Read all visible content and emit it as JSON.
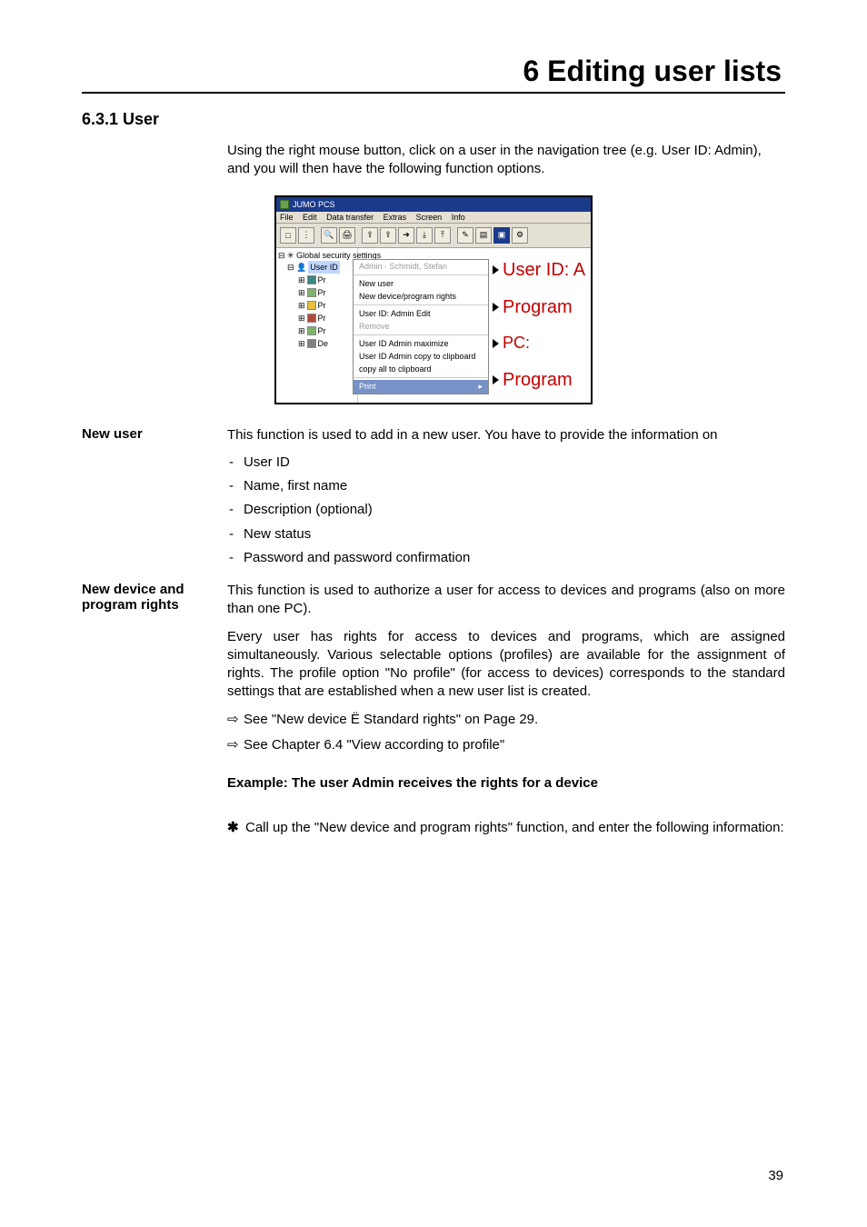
{
  "chapterTitle": "6 Editing user lists",
  "sectionNumber": "6.3.1 User",
  "intro": "Using the right mouse button, click on a user in the navigation tree (e.g. User ID: Admin), and you will then have the following function options.",
  "screenshot": {
    "windowTitle": "JUMO PCS",
    "menu": {
      "file": "File",
      "edit": "Edit",
      "datatransfer": "Data transfer",
      "extras": "Extras",
      "screen": "Screen",
      "info": "Info"
    },
    "treeRoot": "Global security settings",
    "treeUserId": "User ID",
    "treeNodes": {
      "n1": "Pr",
      "n2": "Pr",
      "n3": "Pr",
      "n4": "Pr",
      "n5": "Pr",
      "n6": "De"
    },
    "context": {
      "header": "Admin · Schmidt, Stefan",
      "newUser": "New user",
      "newDevice": "New device/program rights",
      "editUser": "User ID: Admin Edit",
      "remove": "Remove",
      "maximize": "User ID Admin maximize",
      "copyClip": "User ID Admin copy to clipboard",
      "copyAll": "copy all to clipboard",
      "print": "Print"
    },
    "annot": {
      "a1": "User ID: A",
      "a2": "Program",
      "a3": "PC:",
      "a4": "Program"
    }
  },
  "newUser": {
    "label": "New user",
    "text": "This function is used to add in a new user. You have to provide the information on",
    "items": {
      "i1": "User ID",
      "i2": "Name, first name",
      "i3": "Description (optional)",
      "i4": "New status",
      "i5": "Password and password confirmation"
    }
  },
  "newDevice": {
    "label": "New device and program rights",
    "p1": "This function is used to authorize a user for access to devices and programs (also on more than one PC).",
    "p2": "Every user has rights for access to devices and programs, which are assigned simultaneously. Various selectable options (profiles) are available for the assignment of rights. The profile option \"No profile\" (for access to devices) corresponds to the standard settings that are established when a new user list is created.",
    "see1": "See \"New device Ë Standard rights\" on Page  29.",
    "see2": "See Chapter 6.4 \"View according to profile\"",
    "example": "Example: The user Admin receives the rights for a device",
    "star": "Call up the \"New device and program rights\" function, and enter the following information:"
  },
  "pageNumber": "39"
}
